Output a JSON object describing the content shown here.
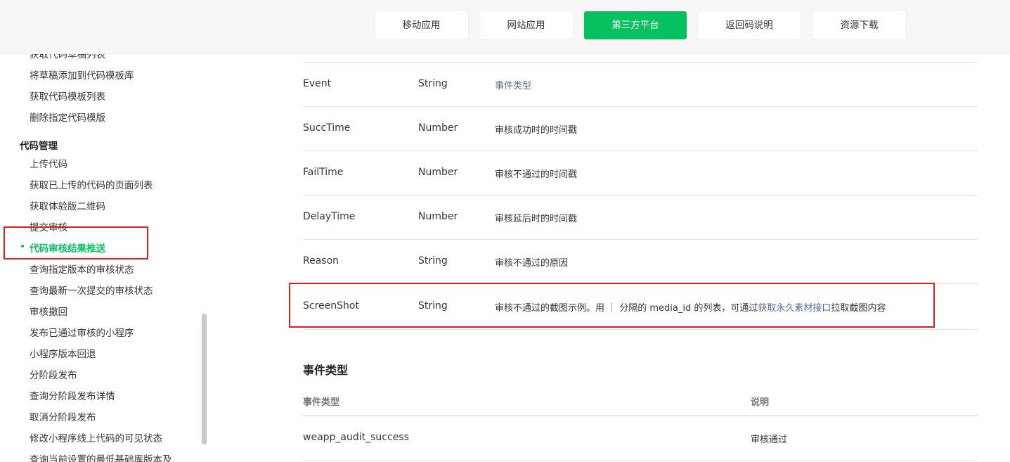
{
  "nav": {
    "tabs": [
      {
        "label": "移动应用"
      },
      {
        "label": "网站应用"
      },
      {
        "label": "第三方平台"
      },
      {
        "label": "返回码说明"
      },
      {
        "label": "资源下载"
      }
    ],
    "active_tab": "第三方平台",
    "accent": "#07c160"
  },
  "sidebar": {
    "items_top": [
      "获取代码草稿列表",
      "将草稿添加到代码模板库",
      "获取代码模板列表",
      "删除指定代码模版"
    ],
    "group_title": "代码管理",
    "items": [
      "上传代码",
      "获取已上传的代码的页面列表",
      "获取体验版二维码",
      "提交审核",
      "代码审核结果推送",
      "查询指定版本的审核状态",
      "查询最新一次提交的审核状态",
      "审核撤回",
      "发布已通过审核的小程序",
      "小程序版本回退",
      "分阶段发布",
      "查询分阶段发布详情",
      "取消分阶段发布",
      "修改小程序线上代码的可见状态",
      "查询当前设置的最低基础库版本及"
    ],
    "active_item": "代码审核结果推送"
  },
  "params_table": {
    "rows": [
      {
        "name": "Event",
        "type": "String",
        "desc": "事件类型"
      },
      {
        "name": "SuccTime",
        "type": "Number",
        "desc": "审核成功时的时间戳"
      },
      {
        "name": "FailTime",
        "type": "Number",
        "desc": "审核不通过的时间戳"
      },
      {
        "name": "DelayTime",
        "type": "Number",
        "desc": "审核延后时的时间戳"
      },
      {
        "name": "Reason",
        "type": "String",
        "desc": "审核不通过的原因"
      },
      {
        "name": "ScreenShot",
        "type": "String",
        "desc_pre": "审核不通过的截图示例。用 ｜ 分隔的 media_id 的列表，可通过",
        "desc_link": "获取永久素材接口",
        "desc_post": "拉取截图内容"
      }
    ]
  },
  "event_types": {
    "title": "事件类型",
    "col_type": "事件类型",
    "col_desc": "说明",
    "rows": [
      {
        "type": "weapp_audit_success",
        "desc": "审核通过"
      }
    ]
  },
  "colors": {
    "highlight_box": "#e02020",
    "link": "#576b95"
  }
}
